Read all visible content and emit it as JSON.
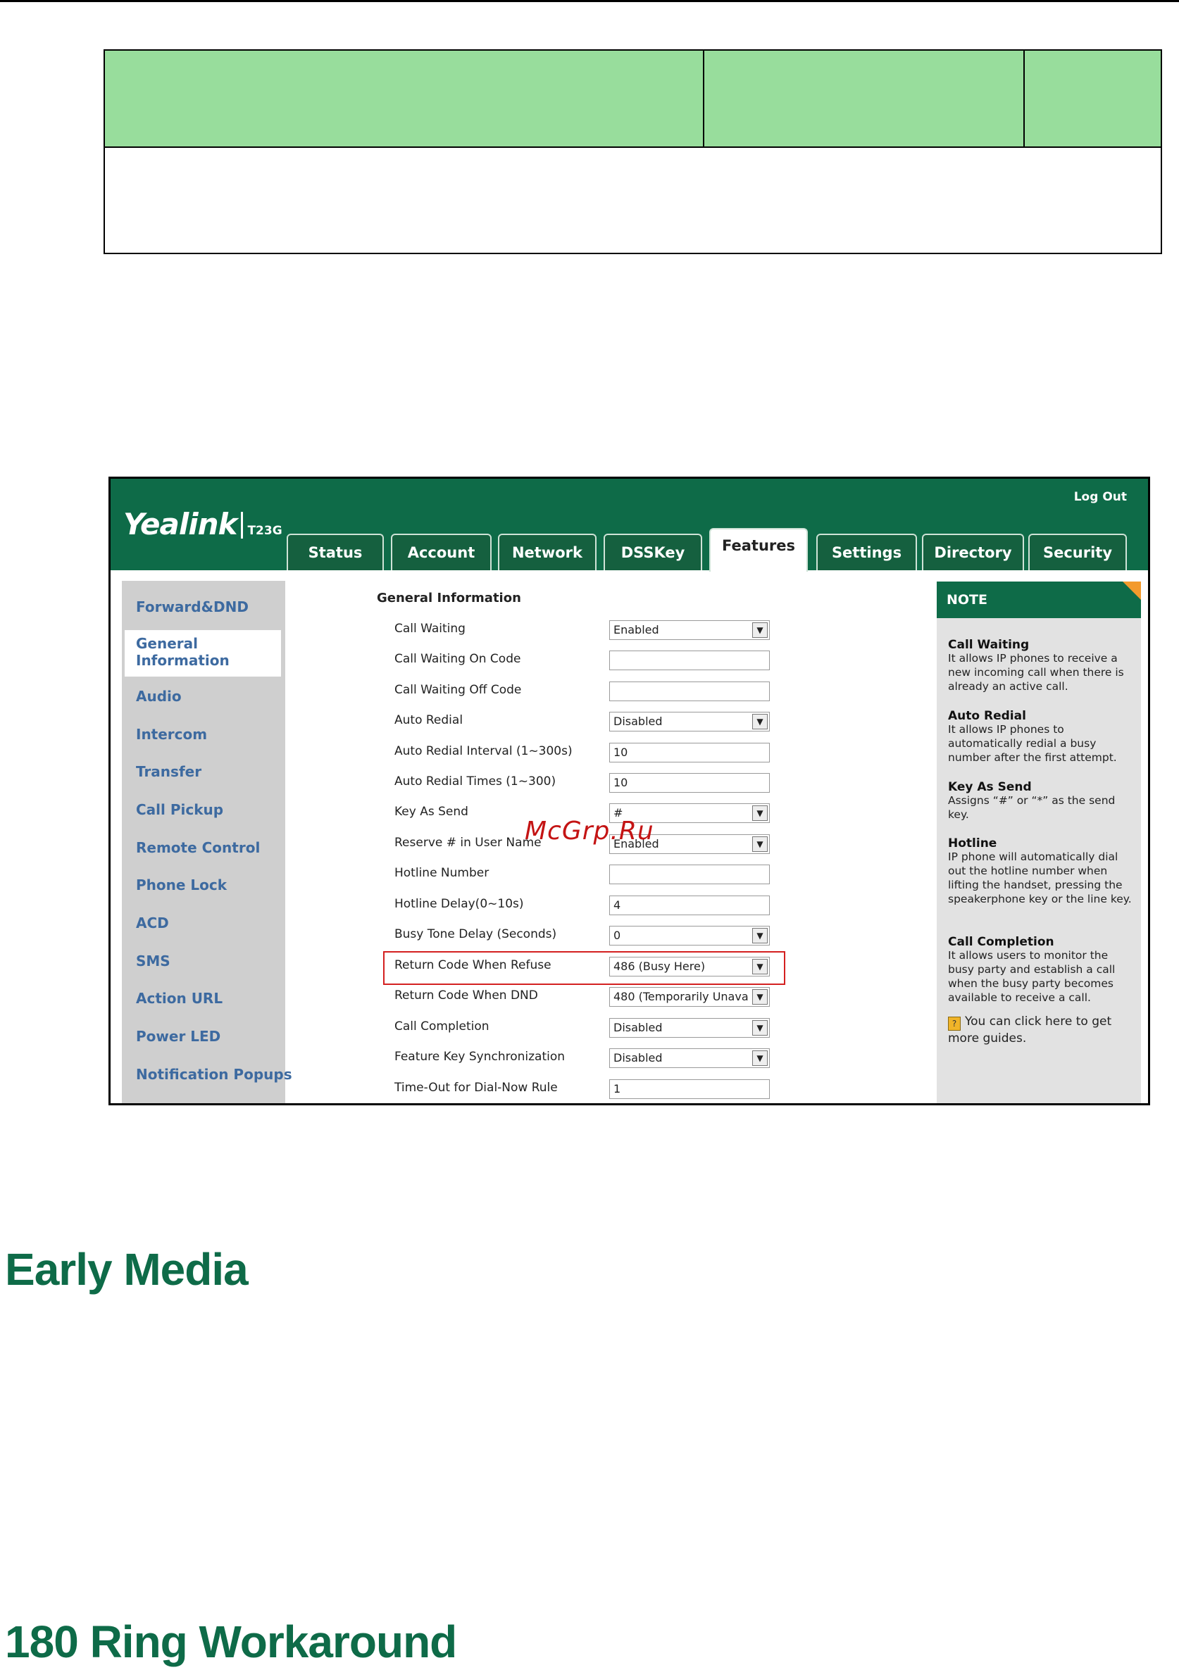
{
  "sidebar": {
    "items": [
      "Forward&DND",
      "General Information",
      "Audio",
      "Intercom",
      "Transfer",
      "Call Pickup",
      "Remote Control",
      "Phone Lock",
      "ACD",
      "SMS",
      "Action URL",
      "Power LED",
      "Notification Popups"
    ]
  },
  "webui": {
    "brand": "Yealink",
    "model": "T23G",
    "logout": "Log Out",
    "tabs": [
      "Status",
      "Account",
      "Network",
      "DSSKey",
      "Features",
      "Settings",
      "Directory",
      "Security"
    ],
    "active_tab": "Features",
    "section_title": "General Information",
    "fields": [
      {
        "label": "Call Waiting",
        "value": "Enabled",
        "type": "select"
      },
      {
        "label": "Call Waiting On Code",
        "value": "",
        "type": "input"
      },
      {
        "label": "Call Waiting Off Code",
        "value": "",
        "type": "input"
      },
      {
        "label": "Auto Redial",
        "value": "Disabled",
        "type": "select"
      },
      {
        "label": "Auto Redial Interval (1~300s)",
        "value": "10",
        "type": "input"
      },
      {
        "label": "Auto Redial Times (1~300)",
        "value": "10",
        "type": "input"
      },
      {
        "label": "Key As Send",
        "value": "#",
        "type": "select"
      },
      {
        "label": "Reserve # in User Name",
        "value": "Enabled",
        "type": "select"
      },
      {
        "label": "Hotline Number",
        "value": "",
        "type": "input"
      },
      {
        "label": "Hotline Delay(0~10s)",
        "value": "4",
        "type": "input"
      },
      {
        "label": "Busy Tone Delay (Seconds)",
        "value": "0",
        "type": "select"
      },
      {
        "label": "Return Code When Refuse",
        "value": "486 (Busy Here)",
        "type": "select"
      },
      {
        "label": "Return Code When DND",
        "value": "480 (Temporarily Unava",
        "type": "select"
      },
      {
        "label": "Call Completion",
        "value": "Disabled",
        "type": "select"
      },
      {
        "label": "Feature Key Synchronization",
        "value": "Disabled",
        "type": "select"
      },
      {
        "label": "Time-Out for Dial-Now Rule",
        "value": "1",
        "type": "input"
      }
    ],
    "note": {
      "header": "NOTE",
      "entries": [
        {
          "title": "Call Waiting",
          "text": "It allows IP phones to receive a new incoming call when there is already an active call."
        },
        {
          "title": "Auto Redial",
          "text": "It allows IP phones to automatically redial a busy number after the first attempt."
        },
        {
          "title": "Key As Send",
          "text": "Assigns “#” or “*” as the send key."
        },
        {
          "title": "Hotline",
          "text": "IP phone will automatically dial out the hotline number when lifting the handset, pressing the speakerphone key or the line key."
        },
        {
          "title": "Call Completion",
          "text": "It allows users to monitor the busy party and establish a call when the busy party becomes available to receive a call."
        }
      ],
      "guide_text": "You can click here to get more guides."
    },
    "watermark": "McGrp.Ru"
  },
  "headings": {
    "early_media": "Early Media",
    "ring_workaround": "180 Ring Workaround"
  },
  "colors": {
    "table_header": "#98dd9c",
    "brand_green": "#0e6b48",
    "highlight_red": "#d42020"
  }
}
